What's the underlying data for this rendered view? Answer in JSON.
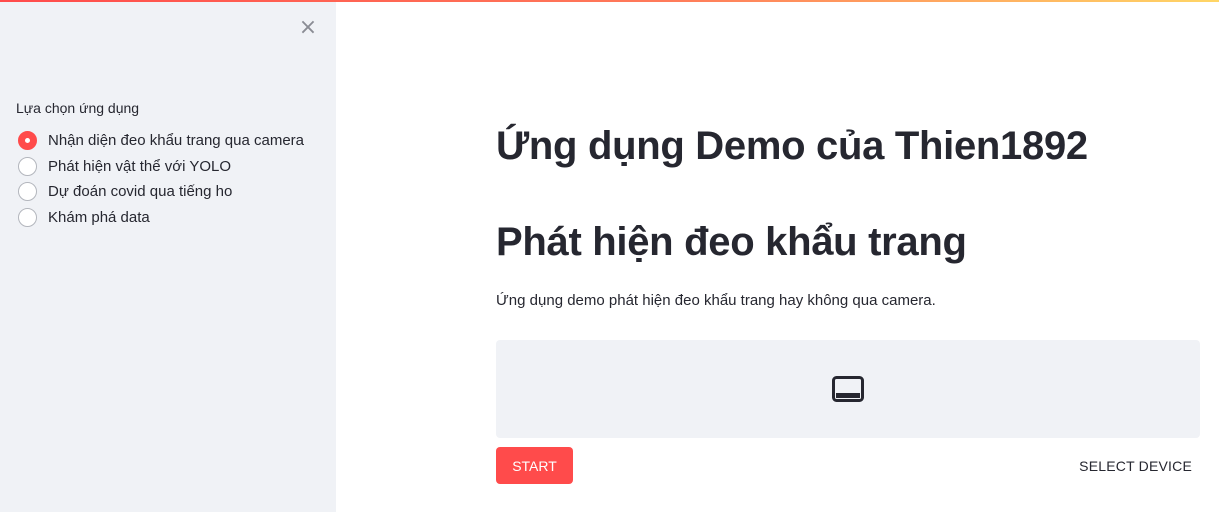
{
  "sidebar": {
    "close_icon": "close-icon",
    "close_glyph": "×",
    "radio_label": "Lựa chọn ứng dụng",
    "options": [
      {
        "label": "Nhận diện đeo khẩu trang qua camera",
        "checked": true
      },
      {
        "label": "Phát hiện vật thể với YOLO",
        "checked": false
      },
      {
        "label": "Dự đoán covid qua tiếng ho",
        "checked": false
      },
      {
        "label": "Khám phá data",
        "checked": false
      }
    ]
  },
  "main": {
    "title": "Ứng dụng Demo của Thien1892",
    "subtitle": "Phát hiện đeo khẩu trang",
    "description": "Ứng dụng demo phát hiện đeo khẩu trang hay không qua camera.",
    "video_icon": "video-display-icon",
    "start_label": "START",
    "select_device_label": "SELECT DEVICE"
  },
  "colors": {
    "accent": "#ff4b4b",
    "sidebar_bg": "#f0f2f6",
    "text": "#262730"
  }
}
